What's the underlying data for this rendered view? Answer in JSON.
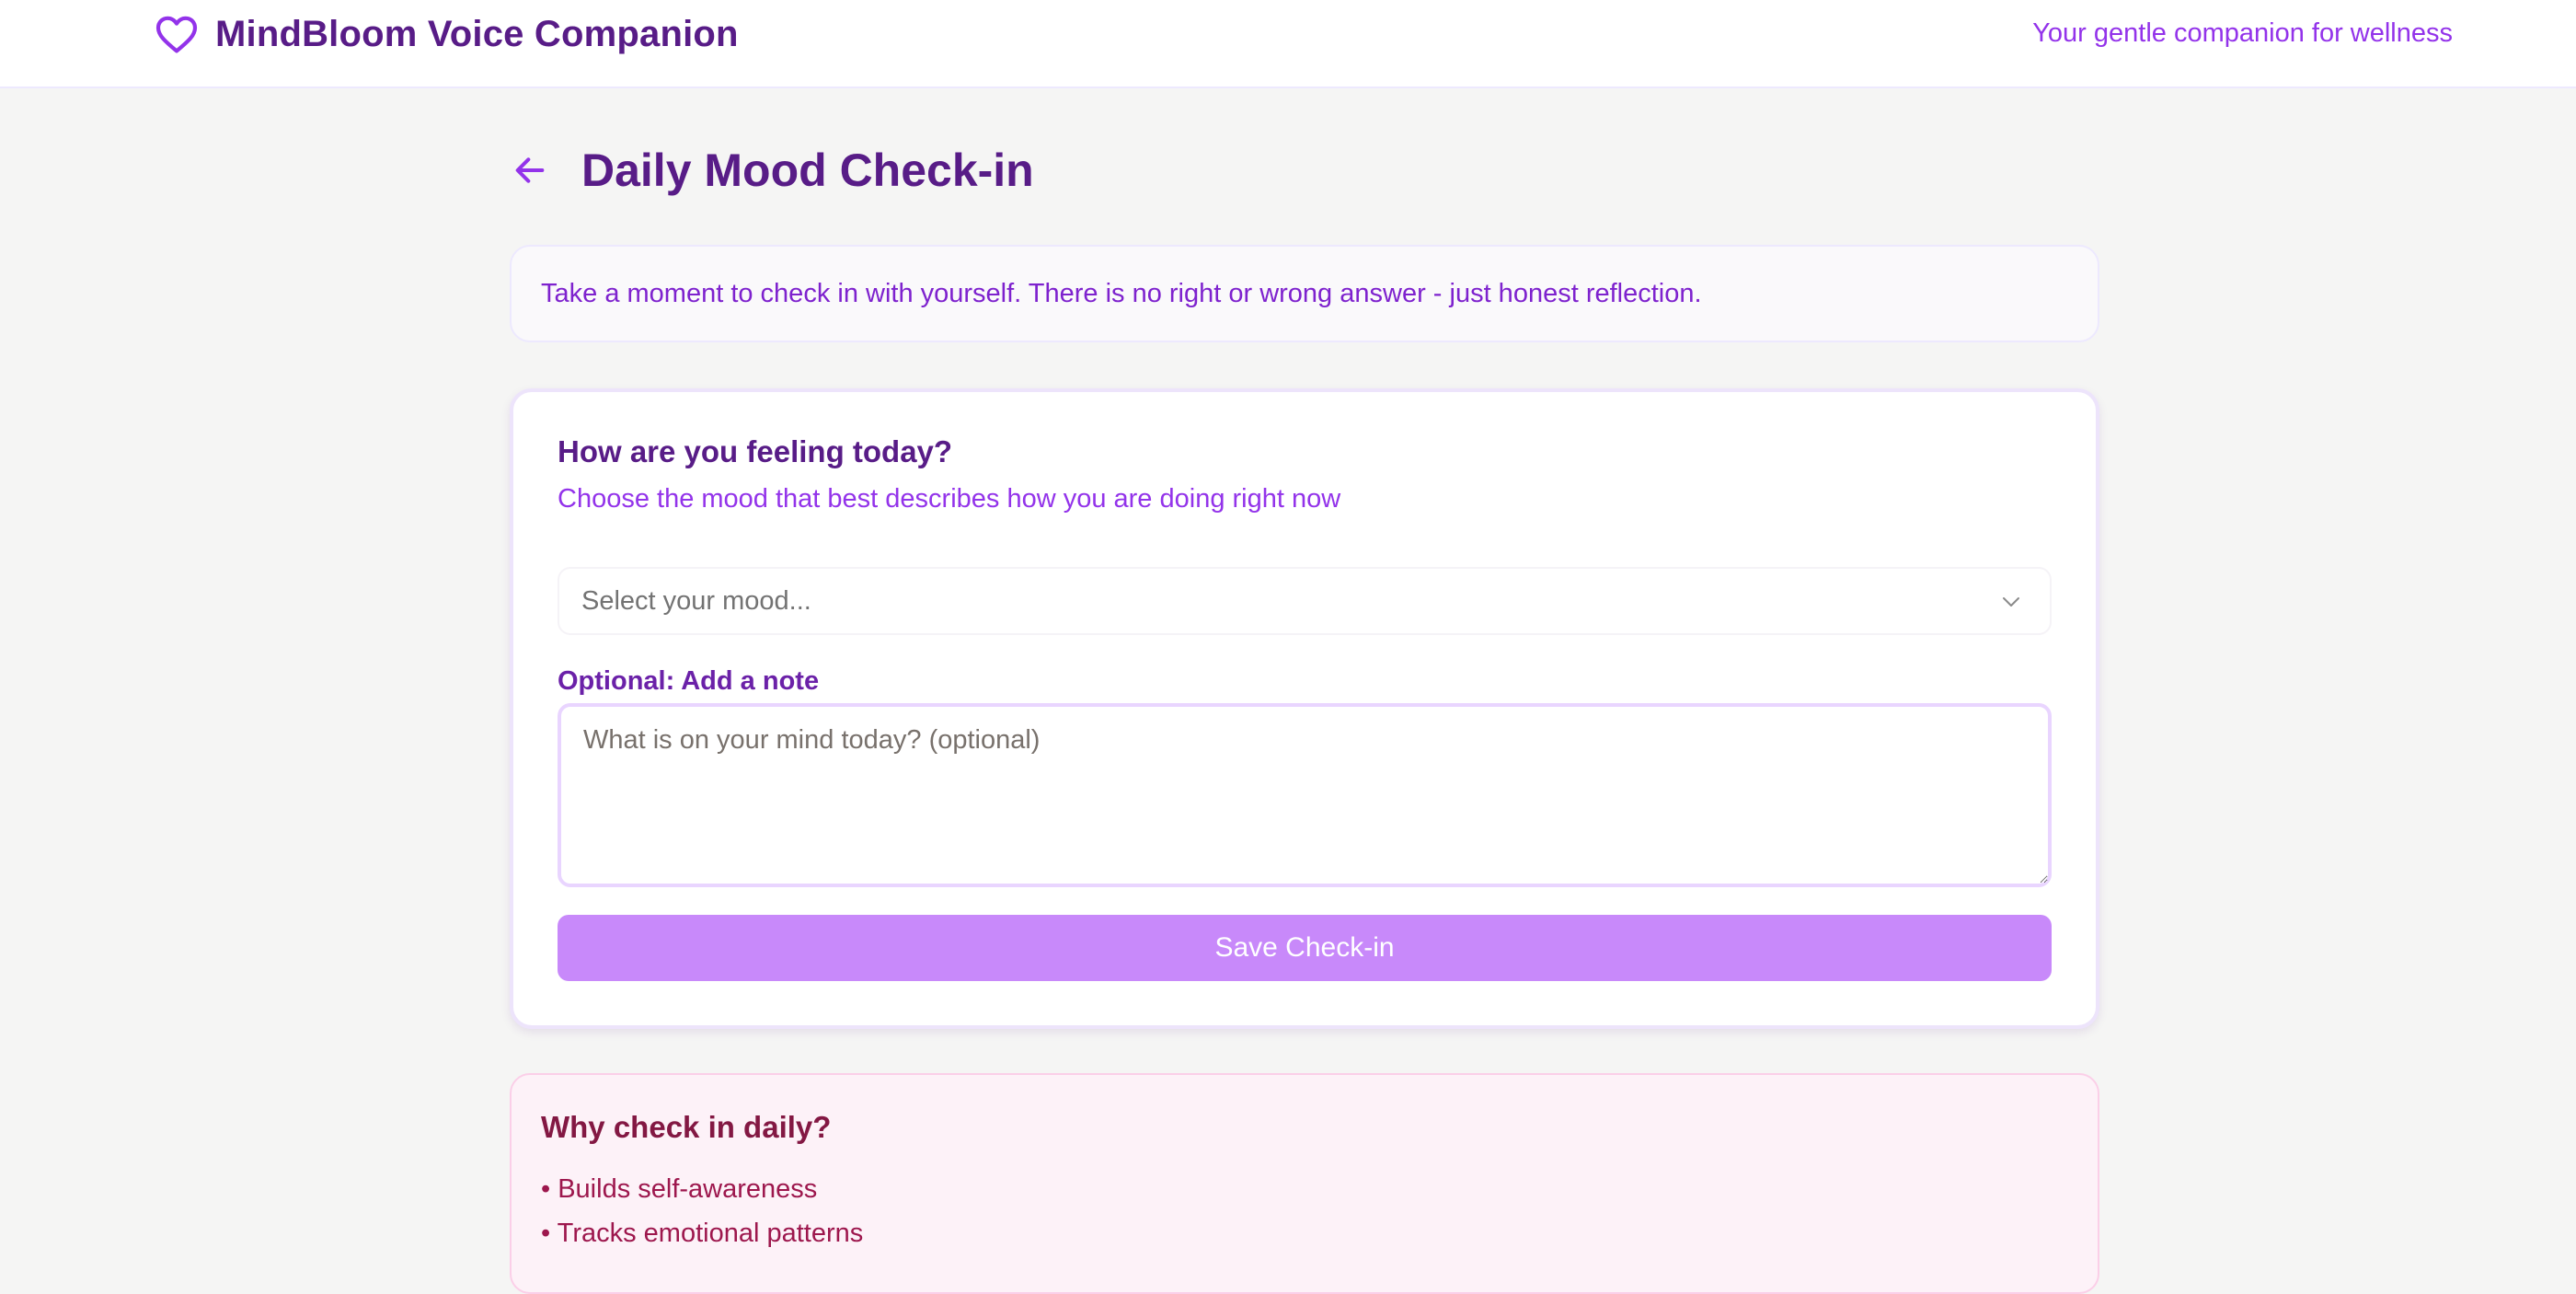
{
  "header": {
    "brand_title": "MindBloom Voice Companion",
    "tagline": "Your gentle companion for wellness",
    "brand_icon": "heart-icon"
  },
  "page": {
    "title": "Daily Mood Check-in",
    "back_icon": "arrow-left-icon"
  },
  "intro": {
    "text": "Take a moment to check in with yourself. There is no right or wrong answer - just honest reflection."
  },
  "mood_form": {
    "question": "How are you feeling today?",
    "subtitle": "Choose the mood that best describes how you are doing right now",
    "select_placeholder": "Select your mood...",
    "note_label": "Optional: Add a note",
    "note_placeholder": "What is on your mind today? (optional)",
    "note_value": "",
    "save_label": "Save Check-in"
  },
  "why": {
    "title": "Why check in daily?",
    "items": [
      "• Builds self-awareness",
      "• Tracks emotional patterns"
    ]
  },
  "colors": {
    "brand": "#581c87",
    "accent": "#9333ea",
    "button": "#c889fa",
    "info_bg": "#fdf2f8",
    "info_text": "#9d174d"
  }
}
